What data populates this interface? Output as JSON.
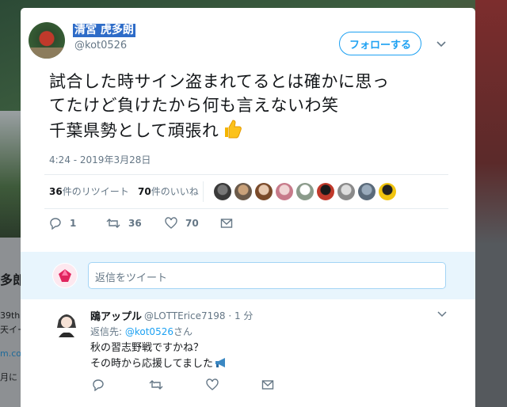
{
  "background": {
    "left_texts": [
      "多郎",
      "39th",
      "天イー",
      "m.co",
      "月に"
    ]
  },
  "tweet": {
    "display_name": "清宮 虎多朗",
    "handle": "@kot0526",
    "follow_label": "フォローする",
    "text_lines": [
      "試合した時サイン盗まれてるとは確かに思っ",
      "てたけど負けたから何も言えないわ笑",
      "千葉県勢として頑張れ"
    ],
    "timestamp": "4:24 - 2019年3月28日",
    "retweets_count": "36",
    "retweets_label": "件のリツイート",
    "likes_count": "70",
    "likes_label": "件のいいね",
    "actions": {
      "reply_count": "1",
      "retweet_count": "36",
      "like_count": "70"
    }
  },
  "reply_box": {
    "placeholder": "返信をツイート"
  },
  "reply": {
    "name": "鴎アップル",
    "handle_time": "@LOTTErice7198 · 1 分",
    "reply_to_prefix": "返信先: ",
    "reply_to_handle": "@kot0526",
    "reply_to_suffix": "さん",
    "line1": "秋の習志野戦ですかね？",
    "line2": "その時から応援してました"
  },
  "colors": {
    "accent": "#1da1f2",
    "selection": "#2e6cc8",
    "reply_box_bg": "#e8f5fd"
  }
}
